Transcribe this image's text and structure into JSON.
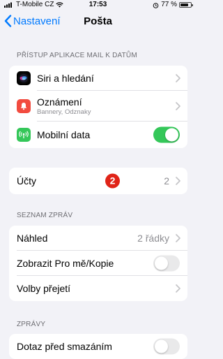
{
  "status_bar": {
    "carrier": "T-Mobile CZ",
    "time": "17:53",
    "battery": "77 %",
    "battery_level": 0.77
  },
  "nav": {
    "back_label": "Nastavení",
    "title": "Pošta"
  },
  "access_section": {
    "header": "PŘÍSTUP APLIKACE MAIL K DATŮM",
    "siri": "Siri a hledání",
    "notifications": {
      "label": "Oznámení",
      "subtitle": "Bannery, Odznaky"
    },
    "mobile_data": {
      "label": "Mobilní data",
      "enabled": true
    }
  },
  "accounts": {
    "label": "Účty",
    "badge": "2",
    "value": "2"
  },
  "message_list": {
    "header": "SEZNAM ZPRÁV",
    "preview": {
      "label": "Náhled",
      "value": "2 řádky"
    },
    "show_to_cc": {
      "label": "Zobrazit Pro mě/Kopie",
      "enabled": false
    },
    "swipe_options": "Volby přejetí"
  },
  "messages": {
    "header": "ZPRÁVY",
    "ask_before_deleting": {
      "label": "Dotaz před smazáním",
      "enabled": false
    }
  },
  "colors": {
    "accent": "#007aff",
    "toggle_on": "#34c759",
    "badge": "#e02418",
    "notifications_icon": "#f24b3f",
    "mobile_data_icon": "#34c759"
  },
  "icons": [
    "siri-icon",
    "bell-icon",
    "antenna-icon",
    "chevron-right-icon",
    "chevron-left-icon",
    "wifi-icon",
    "alarm-icon"
  ]
}
